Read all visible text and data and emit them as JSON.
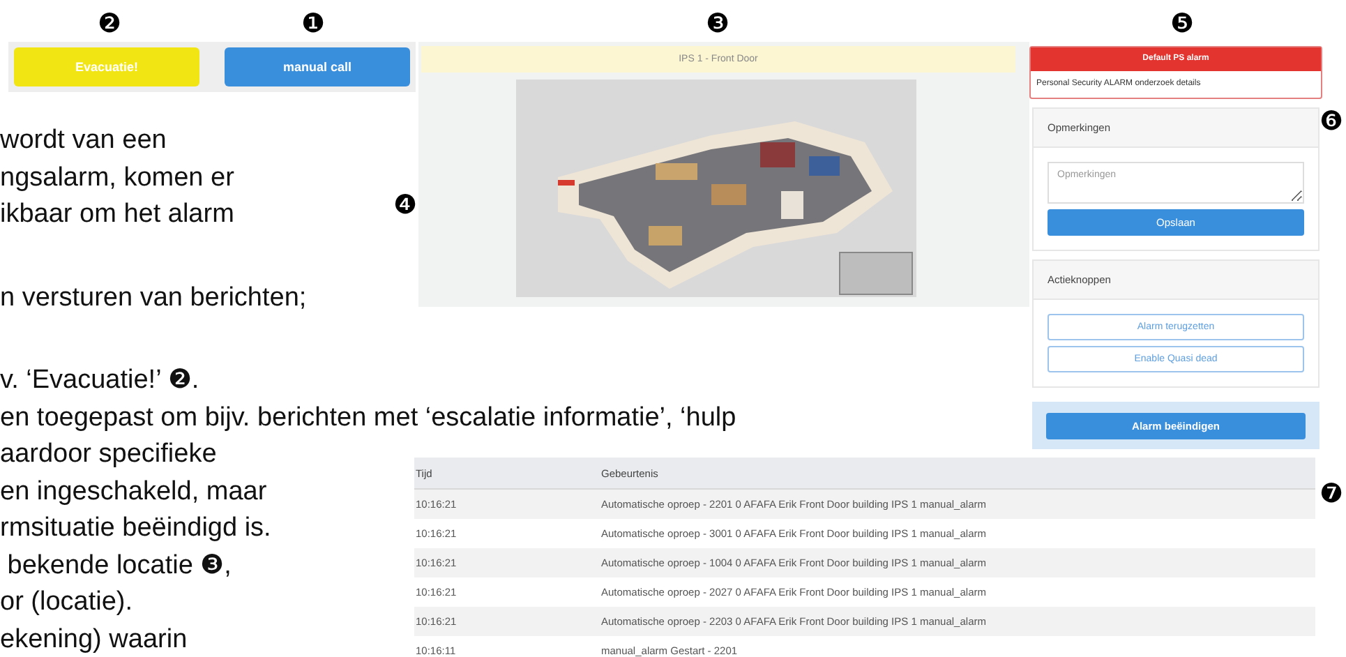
{
  "callouts": [
    "❷",
    "❶",
    "❸",
    "❺",
    "❻",
    "❹",
    "❼"
  ],
  "quick_buttons": [
    {
      "label": "Evacuatie!",
      "color": "#f2e514"
    },
    {
      "label": "manual call",
      "color": "#3a8fdd"
    }
  ],
  "document_blocks": [
    [
      "wordt van een",
      "ngsalarm, komen er",
      "ikbaar om het alarm"
    ],
    [
      "n versturen van berichten;"
    ],
    [
      "v. ‘Evacuatie!’ ❷.",
      "en toegepast om bijv. berichten met ‘escalatie informatie’, ‘hulp",
      "aardoor specifieke",
      "en ingeschakeld, maar",
      "rmsituatie beëindigd is.",
      " bekende locatie ❸,",
      "or (locatie).",
      "ekening) waarin"
    ]
  ],
  "map": {
    "location": "IPS 1 - Front Door",
    "kind": "picture"
  },
  "alarm": {
    "title": "Default PS alarm",
    "details": "Personal Security ALARM onderzoek details"
  },
  "remarks": {
    "title": "Opmerkingen",
    "placeholder": "Opmerkingen",
    "save": "Opslaan"
  },
  "actions": {
    "title": "Actieknoppen",
    "buttons": [
      "Alarm terugzetten",
      "Enable Quasi dead"
    ]
  },
  "end_button": "Alarm beëindigen",
  "log": {
    "columns": [
      "Tijd",
      "Gebeurtenis"
    ],
    "rows": [
      [
        "10:16:21",
        "Automatische oproep - 2201 0 AFAFA Erik Front Door building IPS 1 manual_alarm"
      ],
      [
        "10:16:21",
        "Automatische oproep - 3001 0 AFAFA Erik Front Door building IPS 1 manual_alarm"
      ],
      [
        "10:16:21",
        "Automatische oproep - 1004 0 AFAFA Erik Front Door building IPS 1 manual_alarm"
      ],
      [
        "10:16:21",
        "Automatische oproep - 2027 0 AFAFA Erik Front Door building IPS 1 manual_alarm"
      ],
      [
        "10:16:21",
        "Automatische oproep - 2203 0 AFAFA Erik Front Door building IPS 1 manual_alarm"
      ],
      [
        "10:16:11",
        "manual_alarm Gestart - 2201"
      ]
    ]
  }
}
